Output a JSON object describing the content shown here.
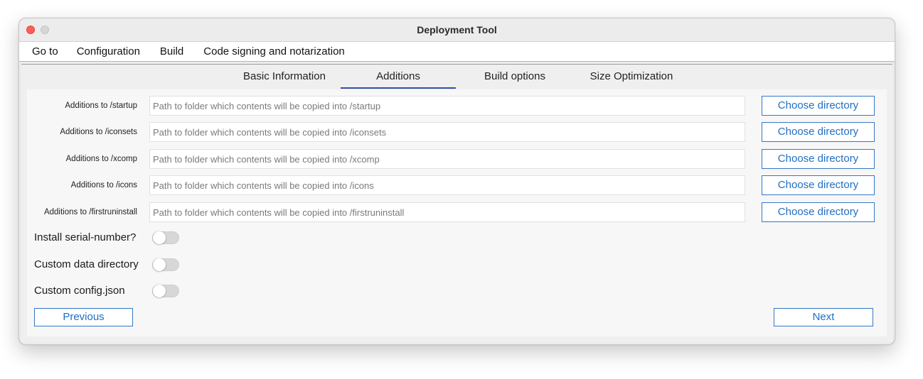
{
  "window": {
    "title": "Deployment Tool"
  },
  "menubar": {
    "items": [
      "Go to",
      "Configuration",
      "Build",
      "Code signing and notarization"
    ]
  },
  "tabs": {
    "items": [
      "Basic Information",
      "Additions",
      "Build options",
      "Size Optimization"
    ],
    "selected": "Additions"
  },
  "additions": [
    {
      "label": "Additions to /startup",
      "placeholder": "Path to folder which contents will be copied into /startup",
      "button": "Choose directory"
    },
    {
      "label": "Additions to /iconsets",
      "placeholder": "Path to folder which contents will be copied into /iconsets",
      "button": "Choose directory"
    },
    {
      "label": "Additions to /xcomp",
      "placeholder": "Path to folder which contents will be copied into /xcomp",
      "button": "Choose directory"
    },
    {
      "label": "Additions to /icons",
      "placeholder": "Path to folder which contents will be copied into /icons",
      "button": "Choose directory"
    },
    {
      "label": "Additions to /firstruninstall",
      "placeholder": "Path to folder which contents will be copied into /firstruninstall",
      "button": "Choose directory"
    }
  ],
  "toggles": [
    {
      "label": "Install serial-number?",
      "on": false
    },
    {
      "label": "Custom data directory",
      "on": false
    },
    {
      "label": "Custom config.json",
      "on": false
    }
  ],
  "navigation": {
    "previous": "Previous",
    "next": "Next"
  },
  "colors": {
    "accent": "#1f6fc5",
    "tab_underline": "#2f4fa8",
    "close_button": "#ff5f57"
  }
}
